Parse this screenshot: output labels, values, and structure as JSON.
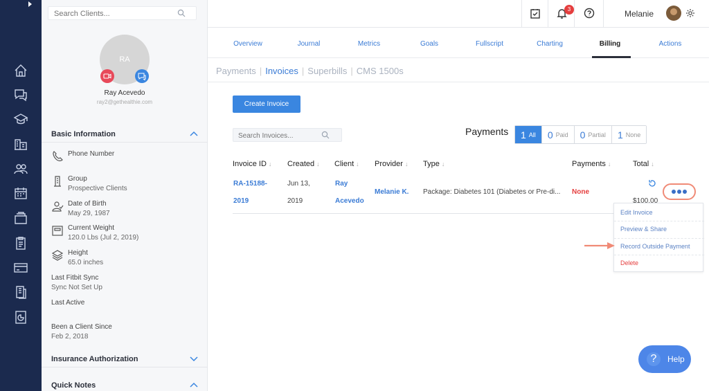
{
  "search": {
    "placeholder": "Search Clients..."
  },
  "client": {
    "initials": "RA",
    "name": "Ray Acevedo",
    "email": "ray2@gethealthie.com"
  },
  "basic_info": {
    "title": "Basic Information",
    "phone_label": "Phone Number",
    "group_label": "Group",
    "group_value": "Prospective Clients",
    "dob_label": "Date of Birth",
    "dob_value": "May 29, 1987",
    "weight_label": "Current Weight",
    "weight_value": "120.0 Lbs (Jul 2, 2019)",
    "height_label": "Height",
    "height_value": "65.0 inches",
    "fitbit_label": "Last Fitbit Sync",
    "fitbit_value": "Sync Not Set Up",
    "active_label": "Last Active",
    "since_label": "Been a Client Since",
    "since_value": "Feb 2, 2018"
  },
  "sections": {
    "insurance": "Insurance Authorization",
    "notes": "Quick Notes"
  },
  "topbar": {
    "notif_count": "3",
    "user": "Melanie"
  },
  "tabs": [
    "Overview",
    "Journal",
    "Metrics",
    "Goals",
    "Fullscript",
    "Charting",
    "Billing",
    "Actions"
  ],
  "subtabs": [
    "Payments",
    "Invoices",
    "Superbills",
    "CMS 1500s"
  ],
  "create_button": "Create Invoice",
  "invoice_search": {
    "placeholder": "Search Invoices..."
  },
  "payments": {
    "title": "Payments",
    "filters": [
      {
        "count": "1",
        "label": "All"
      },
      {
        "count": "0",
        "label": "Paid"
      },
      {
        "count": "0",
        "label": "Partial"
      },
      {
        "count": "1",
        "label": "None"
      }
    ]
  },
  "table": {
    "headers": [
      "Invoice ID",
      "Created",
      "Client",
      "Provider",
      "Type",
      "Payments",
      "Total"
    ],
    "row": {
      "id_line1": "RA-15188-",
      "id_line2": "2019",
      "created_line1": "Jun 13,",
      "created_line2": "2019",
      "client_line1": "Ray",
      "client_line2": "Acevedo",
      "provider": "Melanie K.",
      "type": "Package: Diabetes 101 (Diabetes or Pre-di...",
      "payments": "None",
      "total": "$100.00"
    }
  },
  "menu": [
    "Edit Invoice",
    "Preview & Share",
    "Record Outside Payment",
    "Delete"
  ],
  "help": "Help",
  "colors": {
    "nav": "#1b2a4e",
    "accent": "#3a86e0",
    "danger": "#e53e3e",
    "highlight": "#f08a76"
  }
}
